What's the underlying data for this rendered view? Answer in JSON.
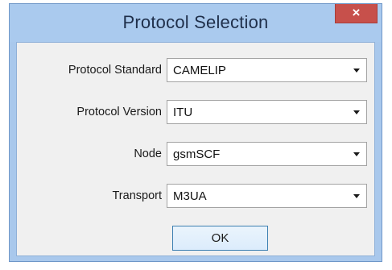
{
  "dialog": {
    "title": "Protocol Selection",
    "close_label": "×"
  },
  "fields": [
    {
      "label": "Protocol Standard",
      "value": "CAMELIP",
      "icon": "chevron-down-icon"
    },
    {
      "label": "Protocol Version",
      "value": "ITU",
      "icon": "chevron-down-icon"
    },
    {
      "label": "Node",
      "value": "gsmSCF",
      "icon": "chevron-down-icon"
    },
    {
      "label": "Transport",
      "value": "M3UA",
      "icon": "chevron-down-icon"
    }
  ],
  "ok_label": "OK",
  "colors": {
    "title_bar": "#aacaee",
    "close_button": "#c7504b",
    "client_bg": "#f0f0f0",
    "ok_border": "#3c7fb1"
  }
}
